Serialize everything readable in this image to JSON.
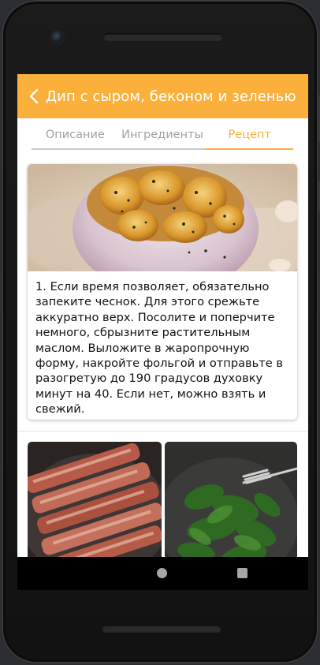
{
  "app": {
    "title": "Дип с сыром, беконом и зеленью"
  },
  "tabs": [
    {
      "label": "Описание",
      "active": false
    },
    {
      "label": "Ингредиенты",
      "active": false
    },
    {
      "label": "Рецепт",
      "active": true
    }
  ],
  "steps": [
    {
      "text": "1. Если время позволяет, обязательно запеките чеснок. Для этого срежьте аккуратно верх. Посолите и поперчите немного, сбрызните растительным маслом. Выложите в жаропрочную форму, накройте фольгой и отправьте в разогретую до 190 градусов духовку минут на 40. Если нет, можно взять и свежий."
    }
  ],
  "colors": {
    "accent": "#fbb03b",
    "tab_inactive": "#a0a0a0",
    "text": "#111111"
  },
  "icons": {
    "back": "chevron-left-icon",
    "home": "home-circle-icon",
    "recents": "recents-square-icon"
  }
}
